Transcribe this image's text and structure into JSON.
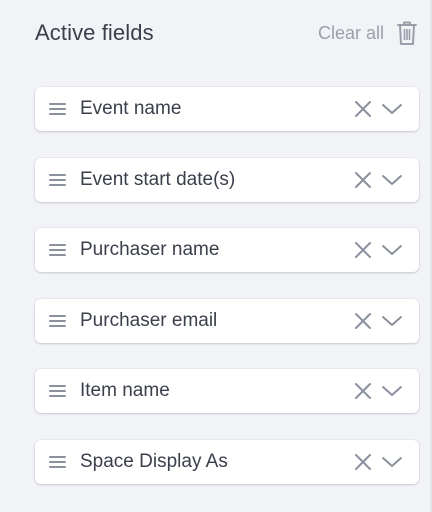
{
  "header": {
    "title": "Active fields",
    "clear_all_label": "Clear all",
    "trash_icon": "trash-icon"
  },
  "colors": {
    "background": "#f2f3f7",
    "card": "#ffffff",
    "text": "#3a3f4b",
    "muted": "#9aa0ab",
    "icon": "#8a909c"
  },
  "fields": [
    {
      "label": "Event name"
    },
    {
      "label": "Event start date(s)"
    },
    {
      "label": "Purchaser name"
    },
    {
      "label": "Purchaser email"
    },
    {
      "label": "Item name"
    },
    {
      "label": "Space Display As"
    }
  ],
  "row_icons": {
    "drag": "drag-handle-icon",
    "remove": "close-icon",
    "expand": "chevron-down-icon"
  }
}
